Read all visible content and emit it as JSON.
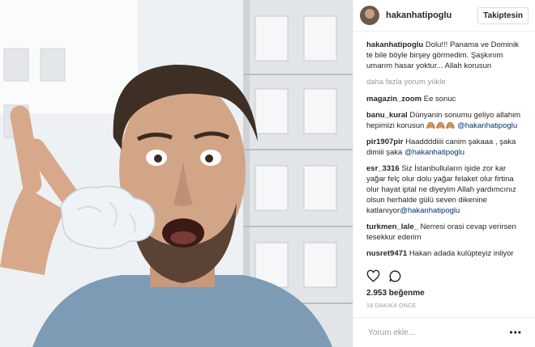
{
  "post": {
    "username": "hakanhatipoglu",
    "follow_label": "Takiptesin",
    "caption_user": "hakanhatipoglu",
    "caption_text": "Dolu!!! Panama ve Dominik te bile böyle birşey görmedim. Şaşkınım umarım hasar yoktur... Allah korusun",
    "load_more": "daha fazla yorum yükle",
    "comments": [
      {
        "user": "magazin_zoom",
        "text": "Ee sonuc",
        "mention": ""
      },
      {
        "user": "banu_kural",
        "text": "Dünyanin sonumu geliyo allahim hepimizi korusun 🙈🙈🙈",
        "mention": "@hakanhatipoglu"
      },
      {
        "user": "pir1907pir",
        "text": "Haaddddiiii canim şakaaa , şaka dimiii şaka",
        "mention": "@hakanhatipoglu"
      },
      {
        "user": "esr_3316",
        "text": "Siz İstanbulluların işide zor kar yağar felç olur dolu yağar felaket olur firtina olur hayat iptal ne diyeyim Allah yardımcınız olsun herhalde gülü seven dikenine katlanıyor",
        "mention": "@hakanhatipoglu"
      },
      {
        "user": "turkmen_lale_",
        "text": "Nerresi orasi cevap verirsen tesekkur ederim",
        "mention": ""
      },
      {
        "user": "nusret9471",
        "text": "Hakan adada kulüpteyiz inliyor",
        "mention": ""
      }
    ],
    "likes": "2.953 beğenme",
    "time": "18 DAKİKA ÖNCE",
    "comment_placeholder": "Yorum ekle...",
    "more_icon": "ellipsis-icon"
  }
}
